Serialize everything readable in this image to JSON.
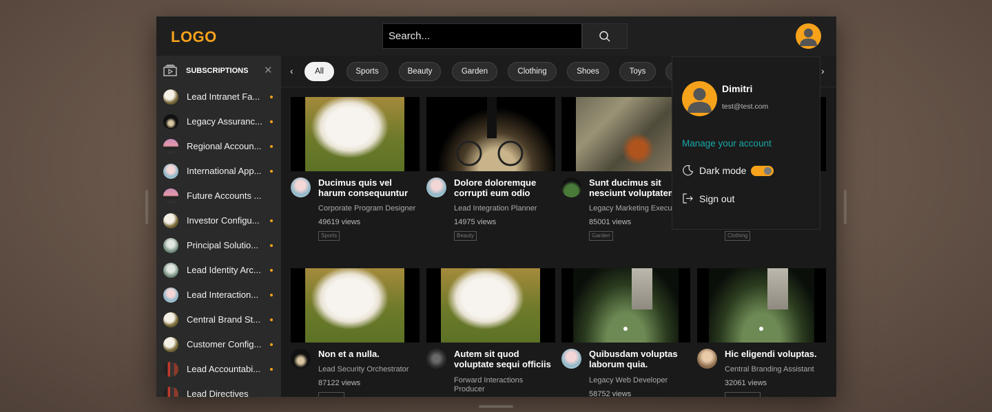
{
  "header": {
    "logo": "LOGO",
    "search_placeholder": "Search..."
  },
  "sidebar": {
    "title": "SUBSCRIPTIONS",
    "items": [
      {
        "label": "Lead Intranet Fa..."
      },
      {
        "label": "Legacy Assuranc..."
      },
      {
        "label": "Regional Accoun..."
      },
      {
        "label": "International App..."
      },
      {
        "label": "Future Accounts ..."
      },
      {
        "label": "Investor Configu..."
      },
      {
        "label": "Principal Solutio..."
      },
      {
        "label": "Lead Identity Arc..."
      },
      {
        "label": "Lead Interaction..."
      },
      {
        "label": "Central Brand St..."
      },
      {
        "label": "Customer Config..."
      },
      {
        "label": "Lead Accountabi..."
      },
      {
        "label": "Lead Directives"
      }
    ]
  },
  "chips": [
    "All",
    "Sports",
    "Beauty",
    "Garden",
    "Clothing",
    "Shoes",
    "Toys"
  ],
  "cards": [
    {
      "title": "Ducimus quis vel harum consequuntur labore...",
      "channel": "Corporate Program Designer",
      "views": "49619 views",
      "tag": "Sports"
    },
    {
      "title": "Dolore doloremque corrupti eum odio reru...",
      "channel": "Lead Integration Planner",
      "views": "14975 views",
      "tag": "Beauty"
    },
    {
      "title": "Sunt ducimus sit nesciunt voluptatem",
      "channel": "Legacy Marketing Execu",
      "views": "85001 views",
      "tag": "Garden"
    },
    {
      "title": "",
      "channel": "",
      "views": "",
      "tag": "Clothing"
    },
    {
      "title": "Non et a nulla.",
      "channel": "Lead Security Orchestrator",
      "views": "87122 views",
      "tag": ""
    },
    {
      "title": "Autem sit quod voluptate sequi officiis animi eni...",
      "channel": "Forward Interactions Producer",
      "views": "",
      "tag": ""
    },
    {
      "title": "Quibusdam voluptas laborum quia.",
      "channel": "Legacy Web Developer",
      "views": "58752 views",
      "tag": ""
    },
    {
      "title": "Hic eligendi voluptas.",
      "channel": "Central Branding Assistant",
      "views": "32061 views",
      "tag": ""
    }
  ],
  "account_menu": {
    "name": "Dimitri",
    "email": "test@test.com",
    "manage": "Manage your account",
    "dark_mode": "Dark mode",
    "dark_mode_on": true,
    "sign_out": "Sign out"
  },
  "colors": {
    "accent": "#f7a21b",
    "link": "#1aa7a7",
    "background": "#1a1a1a"
  }
}
